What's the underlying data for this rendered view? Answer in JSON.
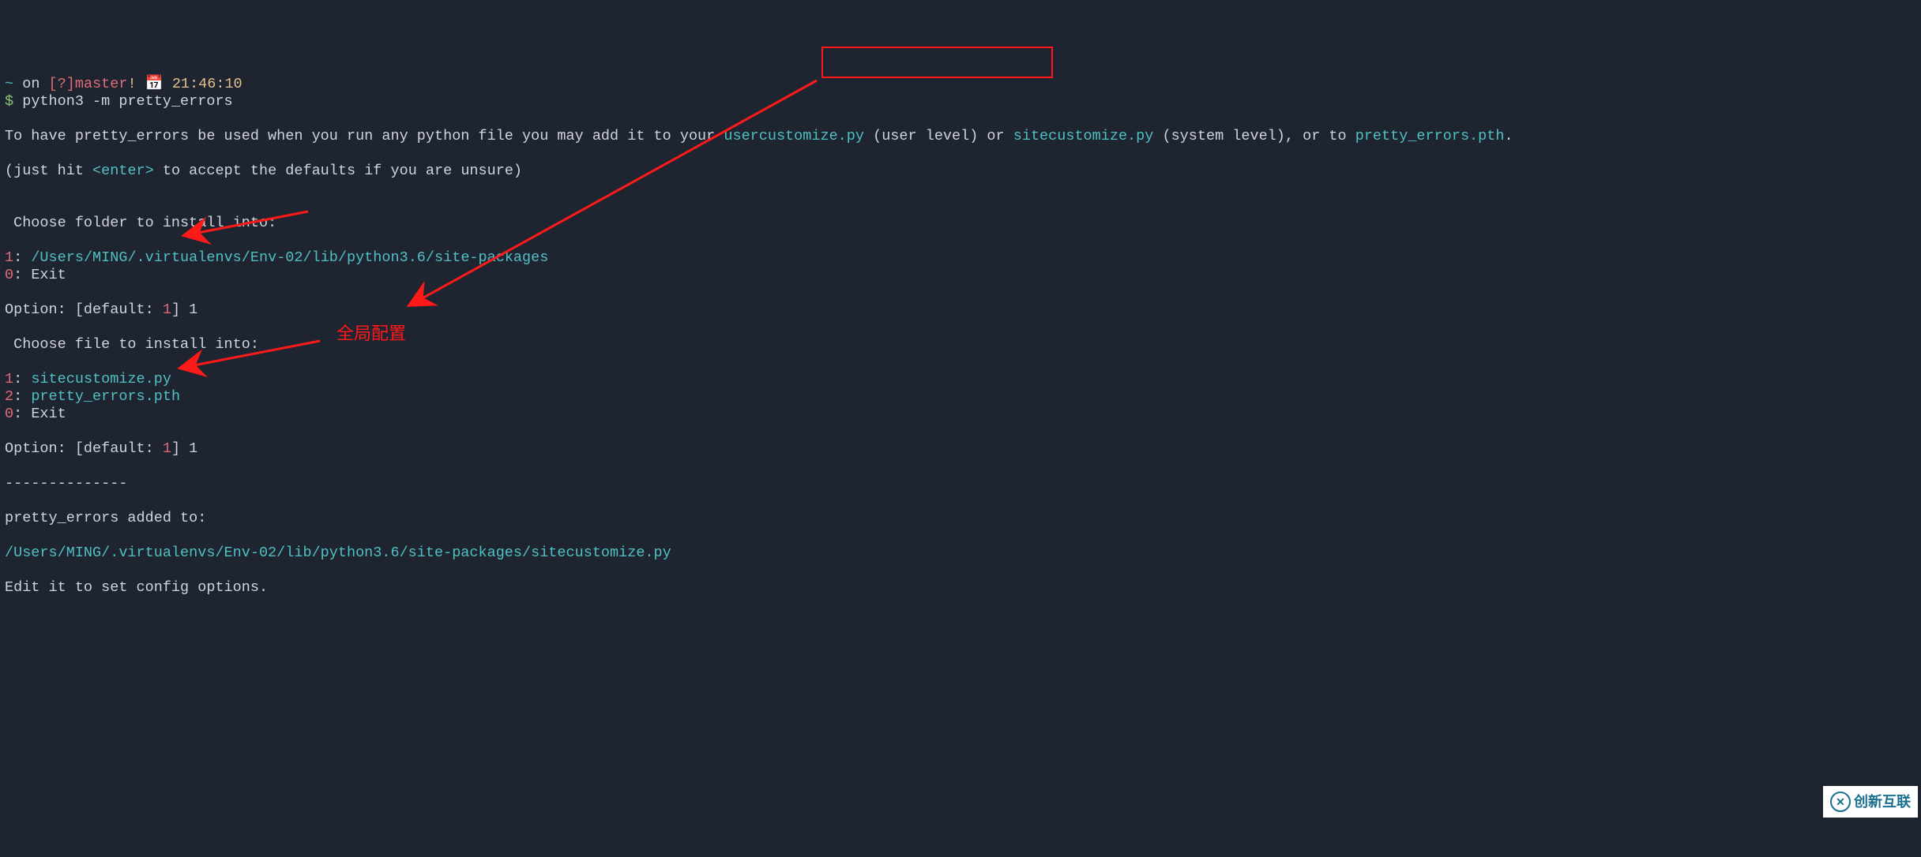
{
  "prompt": {
    "tilde": "~",
    "on": " on ",
    "branch_l": "[?]",
    "branch": "master",
    "branch_bang": "!",
    "clock": " 📅 ",
    "time": "21:46:10",
    "dollar": "$ ",
    "cmd": "python3 -m pretty_errors"
  },
  "l1": {
    "a": "To have pretty_errors be used when you run any python file you may add it to your ",
    "u": "usercustomize.py",
    "b": " (user level) or ",
    "s": "sitecustomize.py",
    "c": " (system level), or to ",
    "p": "pretty_errors.pth",
    "d": "."
  },
  "l2": {
    "a": "(just hit ",
    "e": "<enter>",
    "b": " to accept the defaults if you are unsure)"
  },
  "sec1": {
    "hdr": " Choose folder to install into:",
    "i1n": "1",
    "i1c": ": ",
    "i1p": "/Users/MING/.virtualenvs/Env-02/lib/python3.6/site-packages",
    "i0n": "0",
    "i0c": ": Exit"
  },
  "opt1": {
    "a": "Option: [default: ",
    "d": "1",
    "b": "] ",
    "v": "1"
  },
  "sec2": {
    "hdr": " Choose file to install into:",
    "i1n": "1",
    "i1c": ": ",
    "i1p": "sitecustomize.py",
    "i2n": "2",
    "i2c": ": ",
    "i2p": "pretty_errors.pth",
    "i0n": "0",
    "i0c": ": Exit"
  },
  "opt2": {
    "a": "Option: [default: ",
    "d": "1",
    "b": "] ",
    "v": "1"
  },
  "dash": "--------------",
  "added": "pretty_errors added to:",
  "path": "/Users/MING/.virtualenvs/Env-02/lib/python3.6/site-packages/sitecustomize.py",
  "edit": "Edit it to set config options.",
  "cn": "全局配置",
  "wm": "创新互联"
}
